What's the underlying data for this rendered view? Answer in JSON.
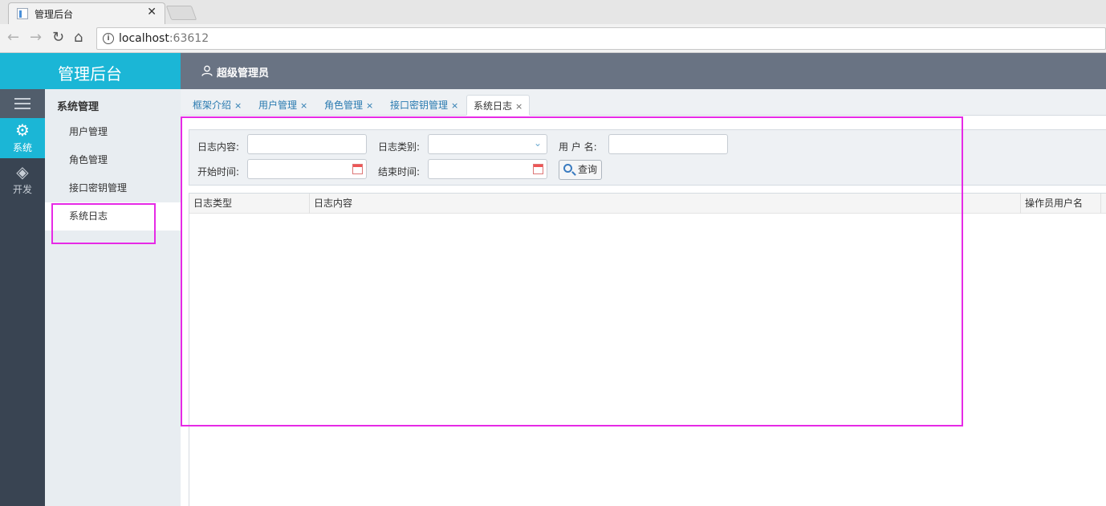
{
  "browser": {
    "tab_title": "管理后台",
    "tab_close": "✕",
    "url_host": "localhost",
    "url_port": ":63612"
  },
  "app": {
    "brand": "管理后台",
    "user": "超级管理员",
    "rail": [
      {
        "label": "系统",
        "icon": "gear-icon",
        "active": true
      },
      {
        "label": "开发",
        "icon": "cube-icon",
        "active": false
      }
    ],
    "submenu": {
      "title": "系统管理",
      "items": [
        "用户管理",
        "角色管理",
        "接口密钥管理",
        "系统日志"
      ],
      "active_index": 3
    },
    "tabs": [
      {
        "label": "框架介绍",
        "close": "×"
      },
      {
        "label": "用户管理",
        "close": "×"
      },
      {
        "label": "角色管理",
        "close": "×"
      },
      {
        "label": "接口密钥管理",
        "close": "×"
      },
      {
        "label": "系统日志",
        "close": "×",
        "active": true
      }
    ],
    "filter": {
      "log_content_label": "日志内容:",
      "log_type_label": "日志类别:",
      "username_label": "用 户 名:",
      "start_time_label": "开始时间:",
      "end_time_label": "结束时间:",
      "log_content_value": "",
      "log_type_value": "",
      "username_value": "",
      "start_time_value": "",
      "end_time_value": "",
      "query_button": "查询"
    },
    "grid": {
      "columns": [
        "日志类型",
        "日志内容",
        "操作员用户名",
        ""
      ],
      "rows": []
    }
  },
  "colors": {
    "brand": "#1bb6d6",
    "header": "#697383",
    "rail": "#394452",
    "highlight": "#e62ae6"
  }
}
